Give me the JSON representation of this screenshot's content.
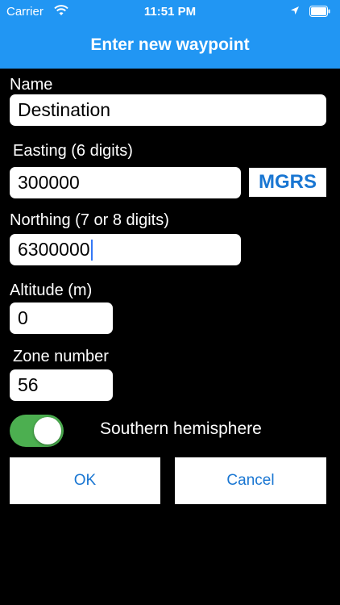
{
  "status_bar": {
    "carrier": "Carrier",
    "time": "11:51 PM",
    "icons": [
      "wifi-icon",
      "location-arrow-icon",
      "battery-icon"
    ]
  },
  "header": {
    "title": "Enter new waypoint",
    "background_color": "#2196F3"
  },
  "form": {
    "name": {
      "label": "Name",
      "value": "Destination"
    },
    "easting": {
      "label": "Easting (6 digits)",
      "value": "300000"
    },
    "mgrs_button": {
      "label": "MGRS"
    },
    "northing": {
      "label": "Northing (7 or 8 digits)",
      "value": "6300000"
    },
    "altitude": {
      "label": "Altitude (m)",
      "value": "0"
    },
    "zone": {
      "label": "Zone number",
      "value": "56"
    },
    "southern_hemisphere": {
      "label": "Southern hemisphere",
      "on": true,
      "on_color": "#4CAF50"
    }
  },
  "actions": {
    "ok_label": "OK",
    "cancel_label": "Cancel",
    "accent_color": "#1976D2"
  }
}
